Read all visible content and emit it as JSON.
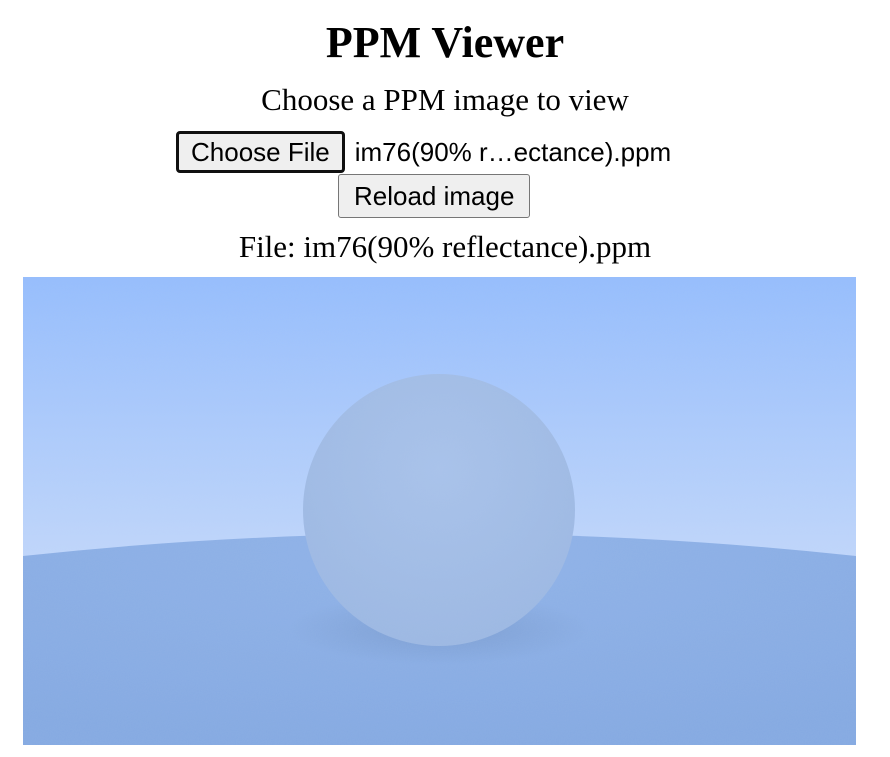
{
  "page": {
    "title": "PPM Viewer",
    "subtitle": "Choose a PPM image to view"
  },
  "file_input": {
    "button_label": "Choose File",
    "selected_file_display": "im76(90% r…ectance).ppm"
  },
  "reload_button": {
    "label": "Reload image"
  },
  "file_info": {
    "label": "File: im76(90% reflectance).ppm"
  },
  "render": {
    "sky_top_color": "#95bdfd",
    "sky_horizon_color": "#c3d8fb",
    "ground_color": "#84a9e2",
    "sphere_color": "#9bb7e2",
    "sphere_shadow_color": "#6f8fbf"
  }
}
